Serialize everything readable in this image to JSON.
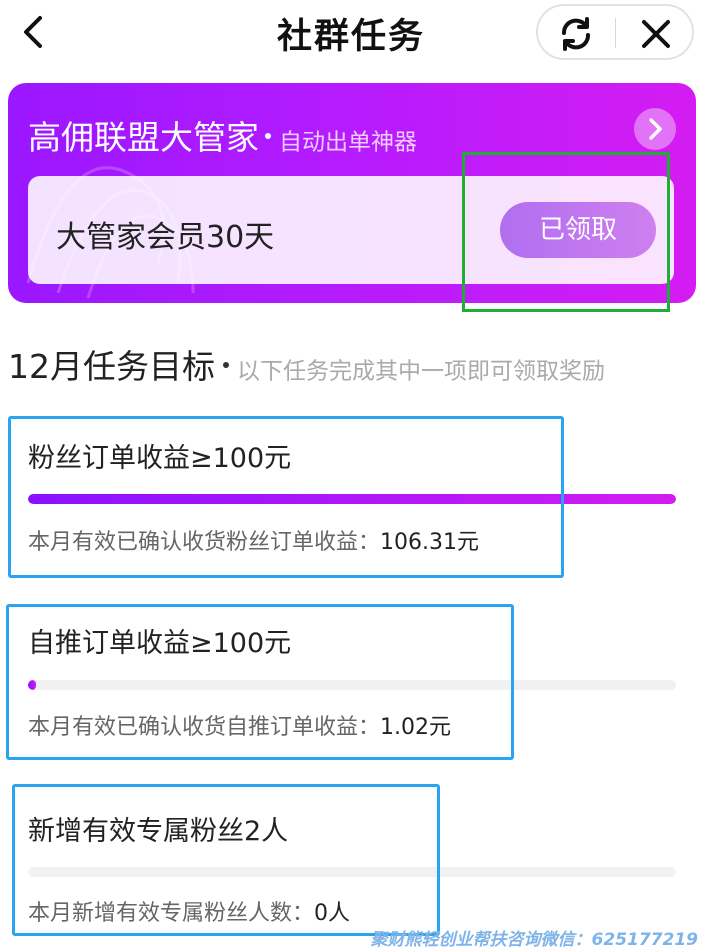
{
  "header": {
    "title": "社群任务",
    "back_icon": "chevron-left-icon",
    "refresh_icon": "refresh-icon",
    "close_icon": "close-icon"
  },
  "banner": {
    "title": "高佣联盟大管家",
    "subtitle": "自动出单神器",
    "arrow_icon": "chevron-right-icon",
    "reward_name": "大管家会员30天",
    "claim_label": "已领取",
    "gradient": [
      "#9a17ff",
      "#d41cf2"
    ]
  },
  "section": {
    "title": "12月任务目标",
    "subtitle": "以下任务完成其中一项即可领取奖励"
  },
  "tasks": [
    {
      "title": "粉丝订单收益≥100元",
      "desc_label": "本月有效已确认收货粉丝订单收益：",
      "desc_value": "106.31元",
      "progress": 1.0
    },
    {
      "title": "自推订单收益≥100元",
      "desc_label": "本月有效已确认收货自推订单收益：",
      "desc_value": "1.02元",
      "progress": 0.0102
    },
    {
      "title": "新增有效专属粉丝2人",
      "desc_label": "本月新增有效专属粉丝人数：",
      "desc_value": "0人",
      "progress": 0
    }
  ],
  "watermark": "聚财熊轻创业帮扶咨询微信：625177219",
  "colors": {
    "accent": "#a21cff",
    "highlight_green": "#1eae32",
    "highlight_blue": "#2aa3f0"
  }
}
